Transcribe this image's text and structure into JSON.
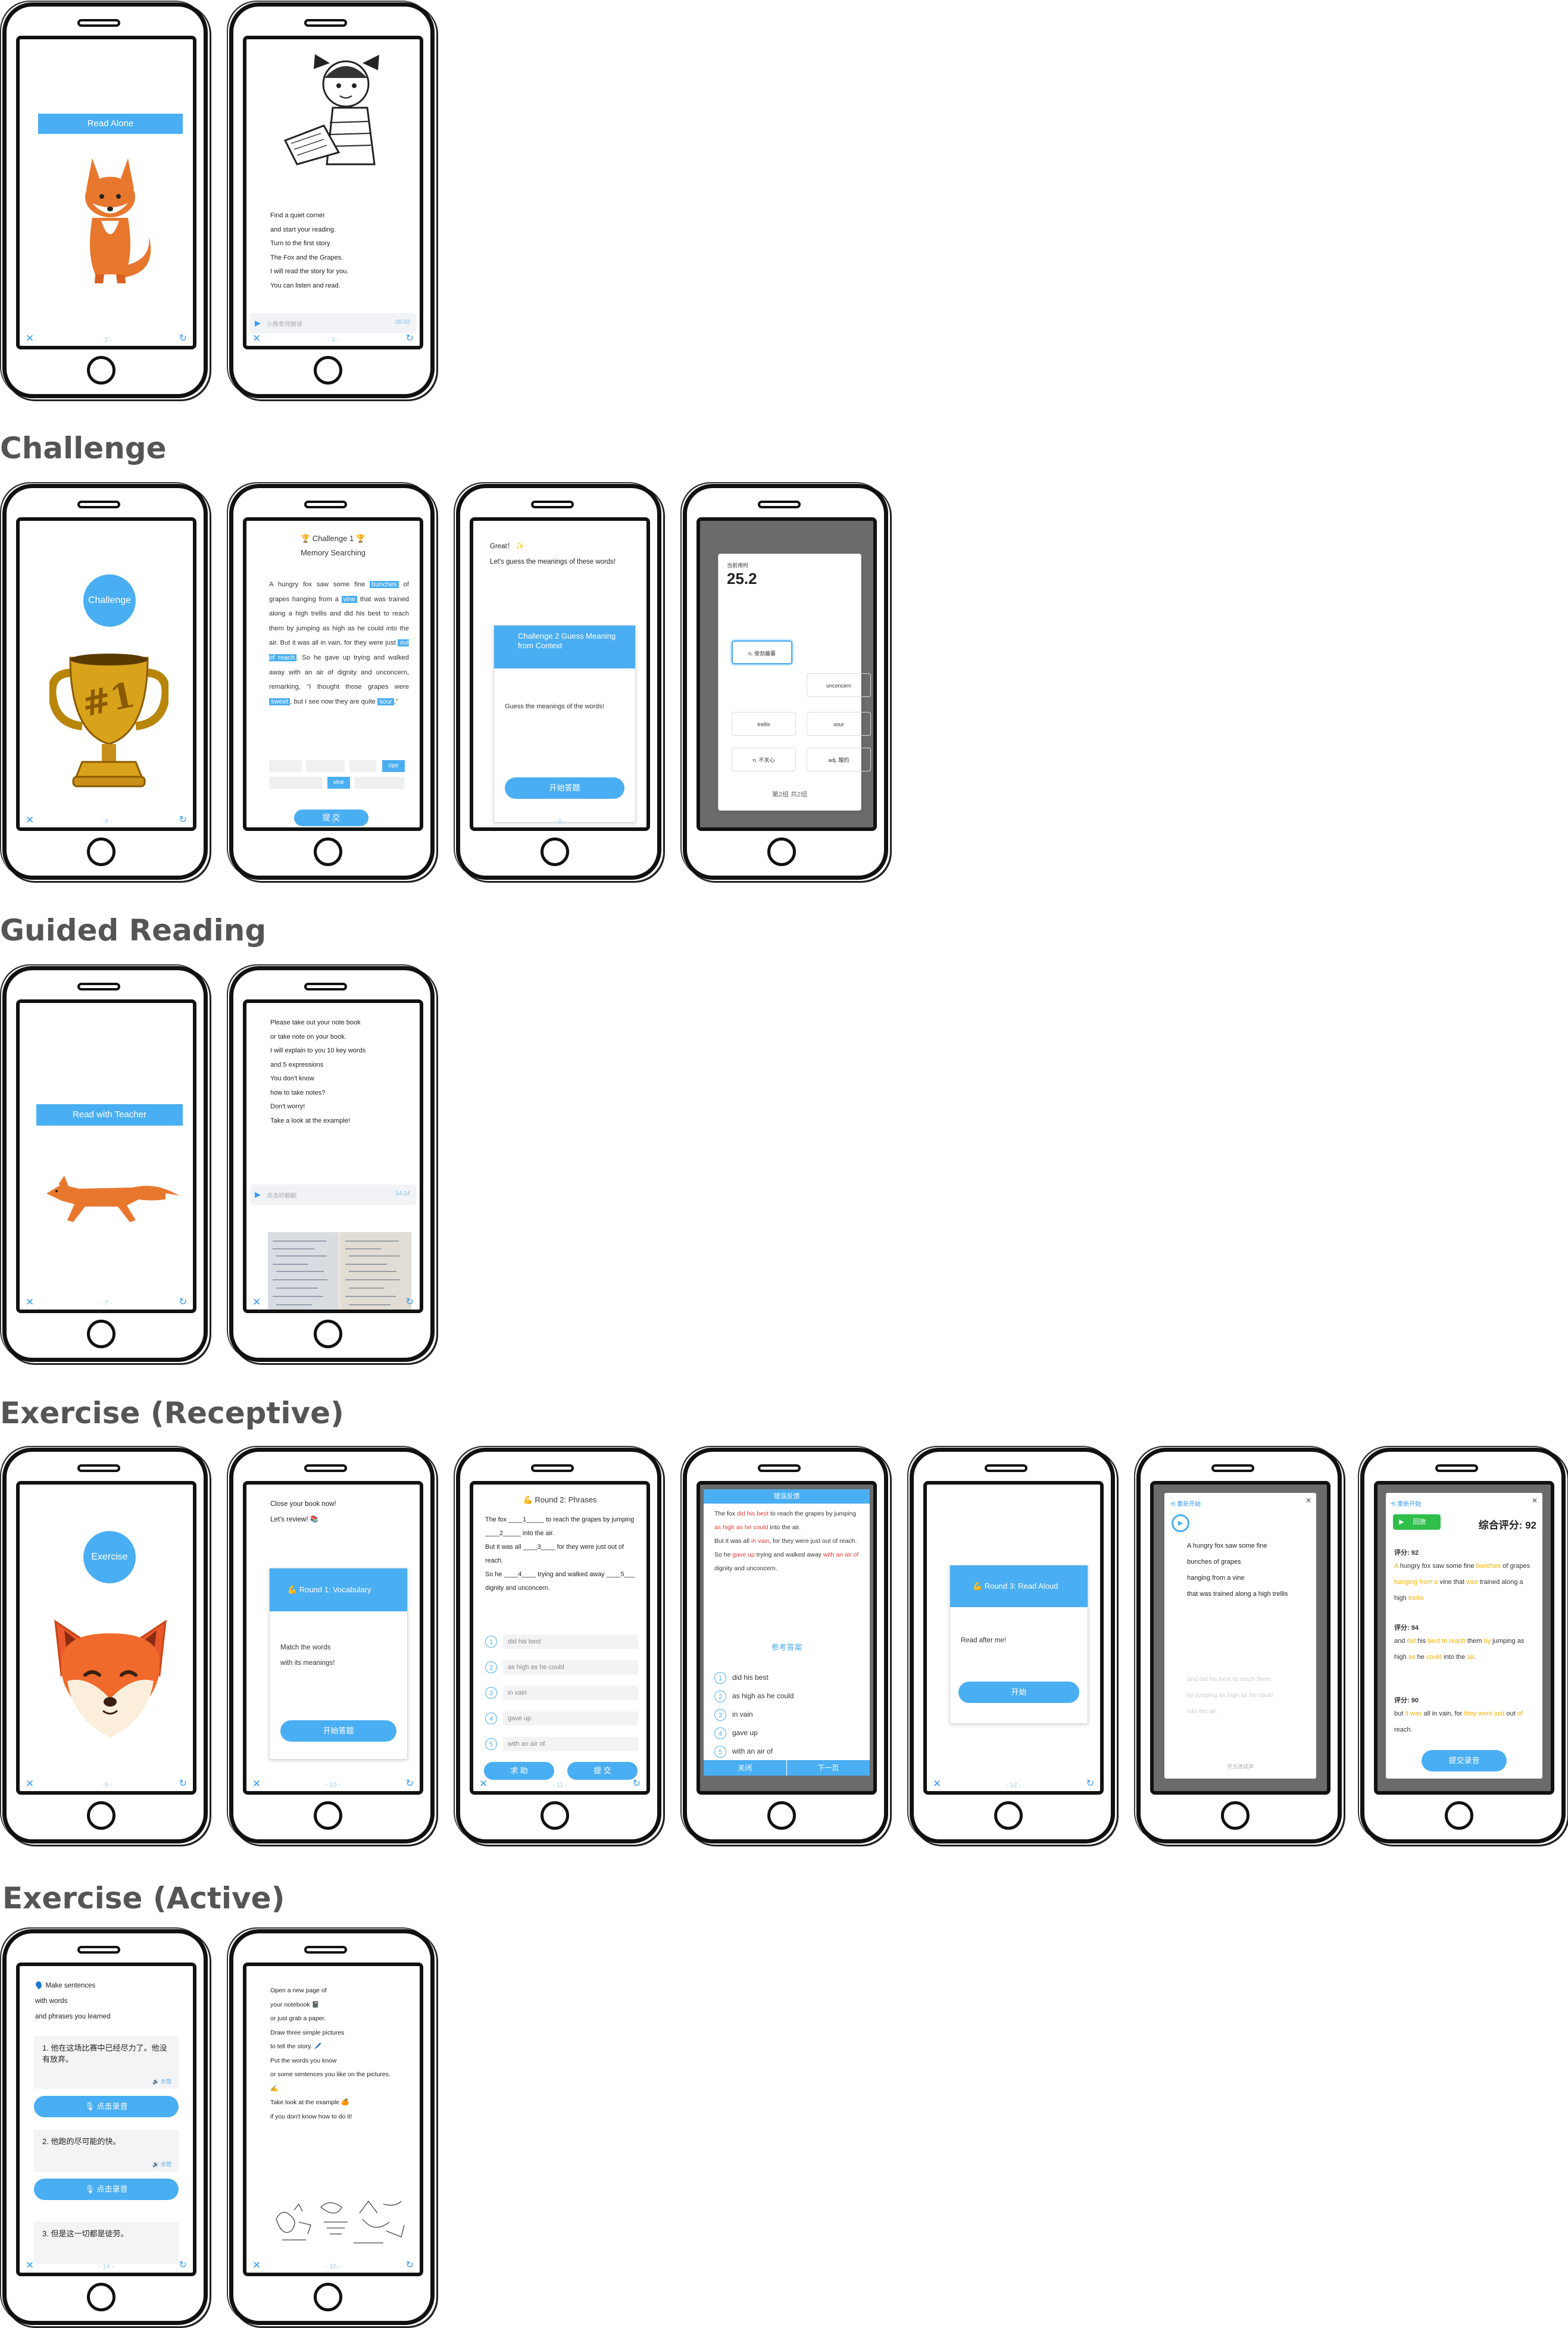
{
  "sections": {
    "challenge": "Challenge",
    "guided_reading": "Guided Reading",
    "exercise_receptive": "Exercise (Receptive)",
    "exercise_active": "Exercise (Active)"
  },
  "screens": {
    "s2": {
      "bar": "Read Alone",
      "page": "- 2 -"
    },
    "s3": {
      "text": "Find a quiet corner\nand start your reading.\nTurn to the first story\nThe Fox and the Grapes.\nI will read the story for you.\nYou can listen and read.",
      "audio_label": "小熊老师朗读",
      "audio_time": "05:02",
      "page": "- 3 -"
    },
    "s4": {
      "badge": "Challenge",
      "page": "- 4 -"
    },
    "s5": {
      "title": "🏆 Challenge 1 🏆",
      "subtitle": "Memory Searching",
      "p1": "A hungry fox saw some fine",
      "h1": "bunches",
      "p2": "of grapes hanging from a",
      "h2": "vine",
      "p3": "that was trained along a high trellis and did his best to reach them by jumping as high as he could into the air. But it was all in vain, for they were just",
      "h3": "out of reach",
      "p4": ". So he gave up trying and walked away with an air of dignity and unconcern, remarking, \"I thought those grapes were",
      "h4": "sweet",
      "p5": ", but I see now they are quite",
      "h5": "sour",
      "p6": ".\"",
      "chip1": "ripe",
      "chip2": "vine",
      "submit": "提 交",
      "page": "- 5 -"
    },
    "s6": {
      "intro": "Great！ ✨\nLet's guess the meanings of these words!",
      "card_title": "Challenge 2 Guess Meaning\nfrom Context",
      "card_text": "Guess the meanings of the words!",
      "start": "开始答题",
      "page": "- 6 -"
    },
    "s6b": {
      "timer_label": "当前用时",
      "timer": "25.2",
      "opt1": "n. 使劲藤蔓",
      "opt2": "unconcern",
      "opt3": "trellis",
      "opt4": "sour",
      "opt5": "n. 不关心",
      "opt6": "adj. 酸的",
      "footer": "第2组 共2组"
    },
    "s7": {
      "bar": "Read with Teacher",
      "page": "- 7 -"
    },
    "s8": {
      "text": "Please take out your note book\nor take note on your book.\nI will explain to you 10 key words\nand 5 expressions\nYou don't know\nhow to take notes?\nDon't worry!\nTake a look at the example!",
      "audio_label": "点击听翻翻",
      "audio_time": "14:14"
    },
    "s9": {
      "badge": "Exercise",
      "page": "- 9 -"
    },
    "s10": {
      "intro": "Close your book now!\nLet's review! 📚",
      "card_title": "💪 Round 1: Vocabulary",
      "card_text": "Match the words\nwith its meanings!",
      "start": "开始答题",
      "page": "- 10 -"
    },
    "s11": {
      "title": "💪 Round 2: Phrases",
      "text": "The fox ____1_____ to reach the grapes by jumping ____2_____ into the air.\nBut it was all ____3____ for they were just out of reach.\nSo he ____4____ trying and walked away ____5___ dignity and unconcern.",
      "opts": [
        "did his best",
        "as high as he could",
        "in vain",
        "gave up",
        "with an air of"
      ],
      "help": "求 助",
      "submit": "提 交",
      "page": "- 11 -"
    },
    "s11b": {
      "head": "错误反馈",
      "line1a": "The fox ",
      "line1b": "did his best",
      "line1c": " to reach the grapes by jumping ",
      "line1d": "as high as he could",
      "line1e": " into the air.",
      "line2a": "But it was all ",
      "line2b": "in vain",
      "line2c": ", for they were just out of reach.",
      "line3a": "So he ",
      "line3b": "gave up",
      "line3c": " trying and walked away ",
      "line3d": "with an air of",
      "line3e": " dignity and unconcern.",
      "ref": "参考答案",
      "answers": [
        "did his best",
        "as high as he could",
        "in vain",
        "gave up",
        "with an air of"
      ],
      "close": "关闭",
      "next": "下一页"
    },
    "s12": {
      "card_title": "💪 Round 3: Read Aloud",
      "card_text": "Read after me!",
      "start": "开始",
      "page": "- 12 -"
    },
    "s12b": {
      "restart": "重新开始",
      "text": "A hungry fox saw some fine\nbunches of grapes\nhanging from a vine\nthat was trained along a high trellis",
      "faded": "and did his best to reach them\nby jumping as high as he could\ninto the air.",
      "footer": "开方连续声"
    },
    "s12c": {
      "restart": "重新开始",
      "play": "回放",
      "total": "综合评分: 92",
      "score1": "评分: 92",
      "score2": "评分: 94",
      "score3": "评分: 90",
      "submit": "提交录音"
    },
    "s13": {
      "intro": "🗣️ Make sentences\nwith words\nand phrases you learned",
      "q1": "1. 他在这场比赛中已经尽力了。他没有放弃。",
      "q2": "2. 他跑的尽可能的快。",
      "q3": "3. 但是这一切都是徒劳。",
      "speaker": "🔊 示范",
      "record": "🎙 点击录音",
      "page": "- 14 -"
    },
    "s14": {
      "text": "Open a new page of\nyour notebook 📓\nor just grab a paper.\nDraw three simple pictures\nto tell the story. 🖊️\nPut the words you know\nor some sentences you like on the pictures.\n✍️\nTake look at the example 🍊\nif you don't know how to do it!",
      "page": "- 15 -"
    }
  }
}
